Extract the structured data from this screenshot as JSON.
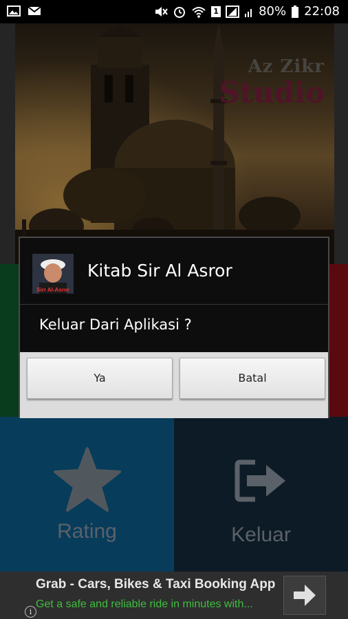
{
  "status_bar": {
    "battery": "80%",
    "time": "22:08",
    "sim_badge": "1"
  },
  "hero": {
    "brand_line1": "Az Zikr",
    "brand_line2": "Studio"
  },
  "tiles": {
    "rating_label": "Rating",
    "exit_label": "Keluar"
  },
  "dialog": {
    "title": "Kitab Sir Al Asror",
    "icon_text_top": "Sirr Al-Asror",
    "message": "Keluar Dari Aplikasi ?",
    "yes_label": "Ya",
    "cancel_label": "Batal"
  },
  "ad": {
    "title": "Grab - Cars, Bikes & Taxi Booking App",
    "subtitle": "Get a safe and reliable ride in minutes with...",
    "info_glyph": "i"
  },
  "colors": {
    "tile_green": "#0f5b2d",
    "tile_red": "#8b0f14",
    "tile_blue": "#0c5c8c",
    "tile_dark": "#152a3b",
    "ad_subtitle": "#3fbf3f",
    "brand_studio": "#7a1f3d"
  }
}
